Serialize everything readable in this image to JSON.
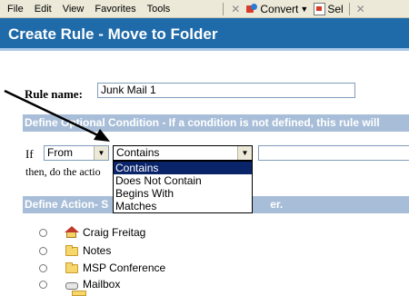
{
  "menubar": {
    "items": [
      "File",
      "Edit",
      "View",
      "Favorites",
      "Tools"
    ],
    "convert_label": "Convert",
    "sel_label": "Sel"
  },
  "title": "Create Rule - Move to Folder",
  "rule_name": {
    "label": "Rule name:",
    "value": "Junk Mail 1"
  },
  "condition": {
    "header": "Define Optional Condition - If a condition is not defined, this rule will",
    "if_label": "If",
    "field_value": "From",
    "operator_value": "Contains",
    "operator_options": [
      "Contains",
      "Does Not Contain",
      "Begins With",
      "Matches"
    ],
    "selected_index": 0,
    "then_text": "then, do the actio"
  },
  "action": {
    "header_left": "Define Action- S",
    "header_right": "er.",
    "folders": [
      {
        "label": "Craig Freitag",
        "icon": "home-icon"
      },
      {
        "label": "Notes",
        "icon": "folder-icon"
      },
      {
        "label": "MSP Conference",
        "icon": "folder-icon"
      },
      {
        "label": "Mailbox",
        "icon": "mailbox-icon"
      }
    ]
  }
}
